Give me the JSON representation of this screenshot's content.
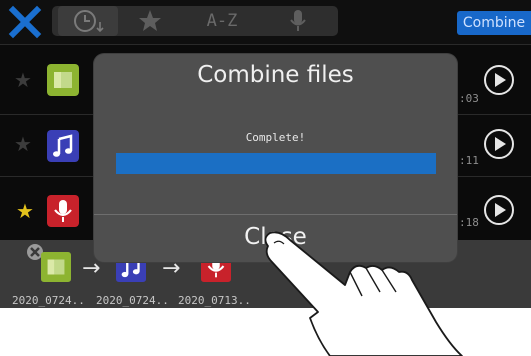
{
  "topbar": {
    "close_icon": "x-icon",
    "sort_tabs": [
      {
        "name": "recent",
        "icon": "clock-sort-icon"
      },
      {
        "name": "favorites",
        "icon": "star-icon"
      },
      {
        "name": "alphabetical",
        "label": "A-Z"
      },
      {
        "name": "recordings",
        "icon": "microphone-icon"
      }
    ],
    "combine_label": "Combine"
  },
  "files": [
    {
      "starred": false,
      "type": "combined",
      "time_suffix": ":03"
    },
    {
      "starred": false,
      "type": "music",
      "time_suffix": ":11"
    },
    {
      "starred": true,
      "type": "recording",
      "time_suffix": ":18"
    }
  ],
  "combine_queue": {
    "items": [
      {
        "type": "combined",
        "name": "2020_0724.."
      },
      {
        "type": "music",
        "name": "2020_0724.."
      },
      {
        "type": "recording",
        "name": "2020_0713.."
      }
    ],
    "arrow": "→"
  },
  "dialog": {
    "title": "Combine files",
    "status": "Complete!",
    "progress": 1.0,
    "close_label": "Close"
  },
  "colors": {
    "accent_blue": "#1868c9",
    "star_yellow": "#e3c21c",
    "combined_icon": "#8db431",
    "music_icon": "#3a3fb6",
    "recording_icon": "#c8222b"
  }
}
